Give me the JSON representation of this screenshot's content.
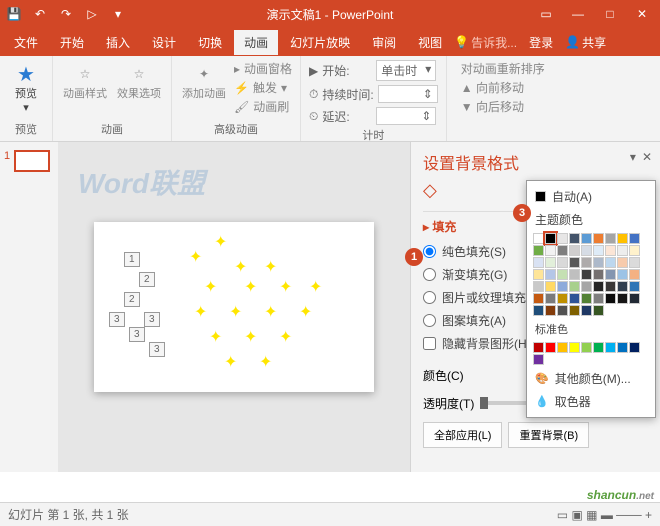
{
  "title": "演示文稿1 - PowerPoint",
  "qat": {
    "save": "💾",
    "undo": "↶",
    "redo": "↷",
    "start": "▷"
  },
  "win": {
    "ribbon": "▭",
    "min": "—",
    "max": "□",
    "close": "✕"
  },
  "tabs": [
    "文件",
    "开始",
    "插入",
    "设计",
    "切换",
    "动画",
    "幻灯片放映",
    "审阅",
    "视图"
  ],
  "active_tab": 5,
  "tell_me": "告诉我...",
  "signin": "登录",
  "share": "共享",
  "ribbon": {
    "preview": {
      "label": "预览",
      "btn": "预览"
    },
    "anim": {
      "label": "动画",
      "style": "动画样式",
      "effect": "效果选项"
    },
    "adv": {
      "label": "高级动画",
      "add": "添加动画",
      "pane": "动画窗格",
      "trigger": "触发",
      "painter": "动画刷"
    },
    "timing": {
      "label": "计时",
      "start": "开始:",
      "start_val": "单击时",
      "duration": "持续时间:",
      "duration_val": "",
      "delay": "延迟:",
      "delay_val": ""
    },
    "reorder": {
      "label": "对动画重新排序",
      "fwd": "向前移动",
      "back": "向后移动"
    }
  },
  "thumb_num": "1",
  "pane": {
    "title": "设置背景格式",
    "section": "填充",
    "opts": {
      "solid": "纯色填充(S)",
      "gradient": "渐变填充(G)",
      "picture": "图片或纹理填充(P)",
      "pattern": "图案填充(A)",
      "hide": "隐藏背景图形(H)"
    },
    "color": "颜色(C)",
    "transparency": "透明度(T)",
    "trans_val": "0%",
    "apply_all": "全部应用(L)",
    "reset": "重置背景(B)"
  },
  "picker": {
    "auto": "自动(A)",
    "theme": "主题颜色",
    "standard": "标准色",
    "more": "其他颜色(M)...",
    "eyedrop": "取色器"
  },
  "theme_colors": [
    [
      "#ffffff",
      "#000000",
      "#e7e6e6",
      "#44546a",
      "#5b9bd5",
      "#ed7d31",
      "#a5a5a5",
      "#ffc000",
      "#4472c4",
      "#70ad47"
    ],
    [
      "#f2f2f2",
      "#7f7f7f",
      "#d0cece",
      "#d6dce5",
      "#deebf7",
      "#fbe5d6",
      "#ededed",
      "#fff2cc",
      "#d9e2f3",
      "#e2efda"
    ],
    [
      "#d9d9d9",
      "#595959",
      "#aeabab",
      "#adb9ca",
      "#bdd7ee",
      "#f7cbac",
      "#dbdbdb",
      "#fee599",
      "#b4c6e7",
      "#c5e0b3"
    ],
    [
      "#bfbfbf",
      "#3f3f3f",
      "#757070",
      "#8496b0",
      "#9cc3e6",
      "#f4b183",
      "#c9c9c9",
      "#ffd965",
      "#8eaadb",
      "#a8d08d"
    ],
    [
      "#a5a5a5",
      "#262626",
      "#3a3838",
      "#323f4f",
      "#2e75b6",
      "#c55a11",
      "#7b7b7b",
      "#bf9000",
      "#2f5496",
      "#538135"
    ],
    [
      "#7f7f7f",
      "#0c0c0c",
      "#171616",
      "#222a35",
      "#1f4e79",
      "#833c0b",
      "#525252",
      "#7f6000",
      "#1f3864",
      "#375623"
    ]
  ],
  "std_colors": [
    "#c00000",
    "#ff0000",
    "#ffc000",
    "#ffff00",
    "#92d050",
    "#00b050",
    "#00b0f0",
    "#0070c0",
    "#002060",
    "#7030a0"
  ],
  "markers": {
    "1": "1",
    "2": "2",
    "3": "3"
  },
  "status": "幻灯片 第 1 张, 共 1 张",
  "watermark": "shancun",
  "wm_slide": "Word联盟"
}
